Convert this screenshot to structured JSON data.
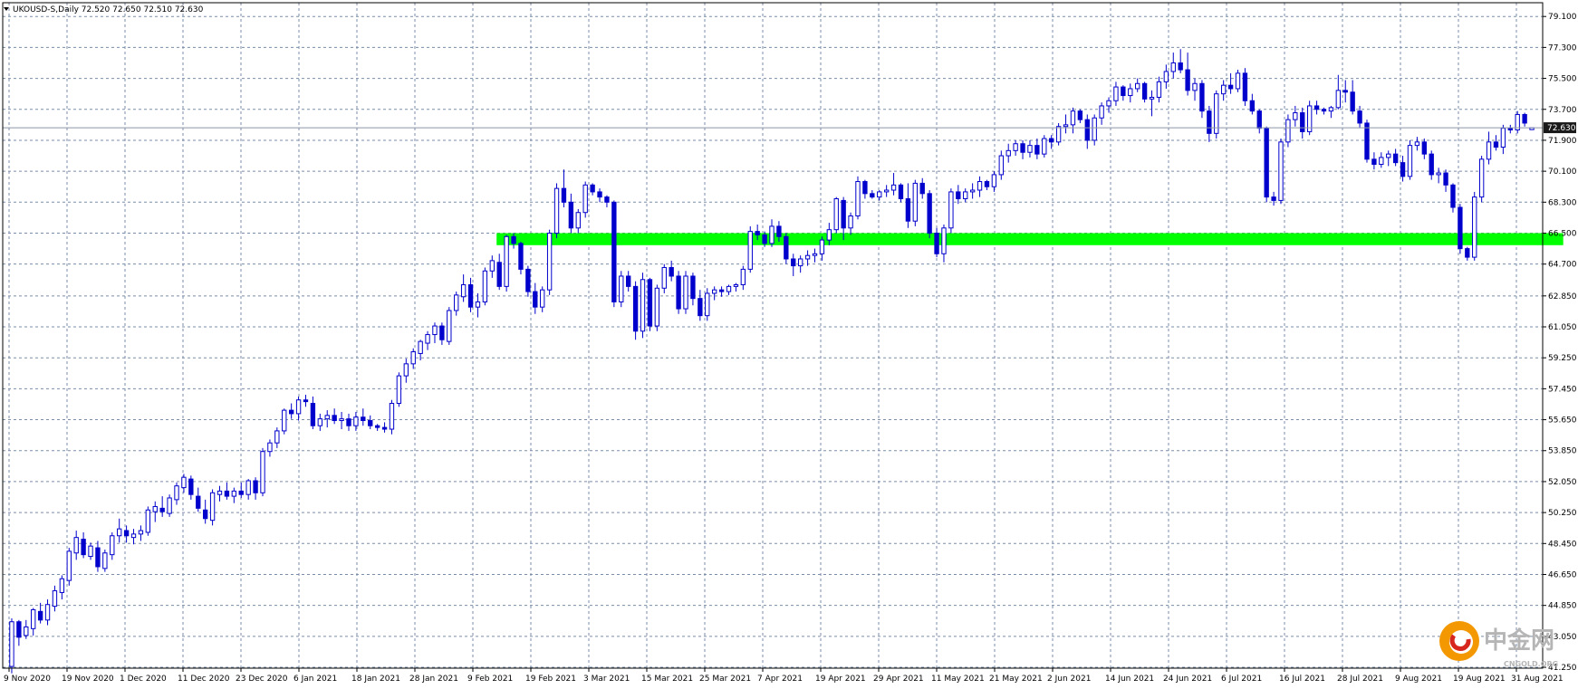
{
  "header": {
    "symbol_line": "UKOUSD-S,Daily  72.520 72.650 72.510 72.630"
  },
  "current_price_label": "72.630",
  "watermark": {
    "name": "中金网",
    "sub": "CNGOLD.ORG"
  },
  "colors": {
    "candle": "#0000cc",
    "support_zone": "#00ff00",
    "grid": "#7b8ea8",
    "frame": "#000000",
    "price_line": "#8c98a8",
    "price_tag": "#1a1a1a",
    "watermark_orange": "#f39800",
    "watermark_red": "#d7261e",
    "watermark_gray": "#b5b5b5"
  },
  "chart_data": {
    "type": "candlestick",
    "symbol": "UKOUSD-S",
    "timeframe": "Daily",
    "ohlc_last": {
      "open": 72.52,
      "high": 72.65,
      "low": 72.51,
      "close": 72.63
    },
    "y_axis": {
      "side": "right",
      "ylim": [
        41.2,
        79.9
      ],
      "ticks": [
        "79.100",
        "77.300",
        "75.500",
        "73.700",
        "71.900",
        "70.100",
        "68.300",
        "66.500",
        "64.700",
        "62.850",
        "61.050",
        "59.250",
        "57.450",
        "55.650",
        "53.850",
        "52.050",
        "50.250",
        "48.450",
        "46.650",
        "44.850",
        "43.050",
        "41.250"
      ]
    },
    "x_axis": {
      "ticks": [
        "9 Nov 2020",
        "19 Nov 2020",
        "1 Dec 2020",
        "11 Dec 2020",
        "23 Dec 2020",
        "6 Jan 2021",
        "18 Jan 2021",
        "28 Jan 2021",
        "9 Feb 2021",
        "19 Feb 2021",
        "3 Mar 2021",
        "15 Mar 2021",
        "25 Mar 2021",
        "7 Apr 2021",
        "19 Apr 2021",
        "29 Apr 2021",
        "11 May 2021",
        "21 May 2021",
        "2 Jun 2021",
        "14 Jun 2021",
        "24 Jun 2021",
        "6 Jul 2021",
        "16 Jul 2021",
        "28 Jul 2021",
        "9 Aug 2021",
        "19 Aug 2021",
        "31 Aug 2021"
      ]
    },
    "grid": true,
    "support_zone": {
      "from": 65.8,
      "to": 66.5
    },
    "current_price": 72.63,
    "candles": [
      [
        41.3,
        44.1,
        40.9,
        43.9
      ],
      [
        43.9,
        44.0,
        42.5,
        43.0
      ],
      [
        43.1,
        44.0,
        42.9,
        43.6
      ],
      [
        43.5,
        44.7,
        43.1,
        44.6
      ],
      [
        44.5,
        45.0,
        43.8,
        44.0
      ],
      [
        44.0,
        45.2,
        43.7,
        44.9
      ],
      [
        44.8,
        46.0,
        44.5,
        45.7
      ],
      [
        45.6,
        46.6,
        45.2,
        46.4
      ],
      [
        46.3,
        48.2,
        46.0,
        48.0
      ],
      [
        47.9,
        49.2,
        47.5,
        48.8
      ],
      [
        48.7,
        49.1,
        47.6,
        47.8
      ],
      [
        47.7,
        48.5,
        47.5,
        48.3
      ],
      [
        48.2,
        48.6,
        46.8,
        47.1
      ],
      [
        47.0,
        48.1,
        46.8,
        47.9
      ],
      [
        47.8,
        49.1,
        47.5,
        48.9
      ],
      [
        48.9,
        49.9,
        48.5,
        49.3
      ],
      [
        49.2,
        49.5,
        48.5,
        48.9
      ],
      [
        48.8,
        49.3,
        48.4,
        49.0
      ],
      [
        49.0,
        49.5,
        48.6,
        49.2
      ],
      [
        49.1,
        50.6,
        48.9,
        50.4
      ],
      [
        50.3,
        50.9,
        49.7,
        50.6
      ],
      [
        50.5,
        51.2,
        50.0,
        50.3
      ],
      [
        50.2,
        51.3,
        50.0,
        51.1
      ],
      [
        51.0,
        52.0,
        50.7,
        51.8
      ],
      [
        51.7,
        52.5,
        51.4,
        52.3
      ],
      [
        52.2,
        52.4,
        51.0,
        51.3
      ],
      [
        51.2,
        51.7,
        50.3,
        50.5
      ],
      [
        50.4,
        51.0,
        49.6,
        49.9
      ],
      [
        49.8,
        51.6,
        49.5,
        51.4
      ],
      [
        51.3,
        51.8,
        50.9,
        51.5
      ],
      [
        51.5,
        52.0,
        51.0,
        51.2
      ],
      [
        51.2,
        51.7,
        50.8,
        51.5
      ],
      [
        51.5,
        52.0,
        51.1,
        51.3
      ],
      [
        51.3,
        52.2,
        51.0,
        52.1
      ],
      [
        52.1,
        52.3,
        51.0,
        51.4
      ],
      [
        51.4,
        54.0,
        51.2,
        53.8
      ],
      [
        53.8,
        54.5,
        53.5,
        54.3
      ],
      [
        54.3,
        55.2,
        54.0,
        55.0
      ],
      [
        55.0,
        56.3,
        54.8,
        56.2
      ],
      [
        56.2,
        56.6,
        55.7,
        56.0
      ],
      [
        56.0,
        57.0,
        55.6,
        56.8
      ],
      [
        56.8,
        57.1,
        56.4,
        56.7
      ],
      [
        56.6,
        57.0,
        55.1,
        55.3
      ],
      [
        55.3,
        56.0,
        55.0,
        55.7
      ],
      [
        55.7,
        56.2,
        55.2,
        55.9
      ],
      [
        55.9,
        56.3,
        55.4,
        55.6
      ],
      [
        55.6,
        56.1,
        55.1,
        55.7
      ],
      [
        55.7,
        56.0,
        55.0,
        55.3
      ],
      [
        55.3,
        56.1,
        55.0,
        55.8
      ],
      [
        55.8,
        56.3,
        55.3,
        55.6
      ],
      [
        55.6,
        55.9,
        55.1,
        55.3
      ],
      [
        55.3,
        55.4,
        55.0,
        55.2
      ],
      [
        55.2,
        55.5,
        54.9,
        55.1
      ],
      [
        55.1,
        56.8,
        54.8,
        56.6
      ],
      [
        56.6,
        58.4,
        56.4,
        58.2
      ],
      [
        58.2,
        59.2,
        57.8,
        58.9
      ],
      [
        58.9,
        59.8,
        58.6,
        59.6
      ],
      [
        59.5,
        60.3,
        59.1,
        60.2
      ],
      [
        60.1,
        60.8,
        59.7,
        60.6
      ],
      [
        60.6,
        61.3,
        60.1,
        61.1
      ],
      [
        61.1,
        61.3,
        60.0,
        60.3
      ],
      [
        60.2,
        62.2,
        60.0,
        62.0
      ],
      [
        62.0,
        63.1,
        61.7,
        62.9
      ],
      [
        62.8,
        64.1,
        62.5,
        63.5
      ],
      [
        63.5,
        63.9,
        61.9,
        62.2
      ],
      [
        62.2,
        63.0,
        61.6,
        62.5
      ],
      [
        62.5,
        64.5,
        62.3,
        64.3
      ],
      [
        64.3,
        65.2,
        63.9,
        64.9
      ],
      [
        64.8,
        65.3,
        63.2,
        63.4
      ],
      [
        63.4,
        66.4,
        63.1,
        66.3
      ],
      [
        66.3,
        66.5,
        65.6,
        65.9
      ],
      [
        65.9,
        66.0,
        64.1,
        64.4
      ],
      [
        64.4,
        64.6,
        62.8,
        63.1
      ],
      [
        63.1,
        63.6,
        61.8,
        62.2
      ],
      [
        62.2,
        63.4,
        61.9,
        63.2
      ],
      [
        63.2,
        66.7,
        62.9,
        66.5
      ],
      [
        66.5,
        69.4,
        66.2,
        69.1
      ],
      [
        69.1,
        70.2,
        68.0,
        68.3
      ],
      [
        68.3,
        68.8,
        66.5,
        66.8
      ],
      [
        66.8,
        67.9,
        66.5,
        67.7
      ],
      [
        67.7,
        69.5,
        67.4,
        69.3
      ],
      [
        69.3,
        69.4,
        68.7,
        68.9
      ],
      [
        68.9,
        69.1,
        68.3,
        68.6
      ],
      [
        68.6,
        68.7,
        68.0,
        68.3
      ],
      [
        68.3,
        68.4,
        62.2,
        62.5
      ],
      [
        62.5,
        64.3,
        62.2,
        64.0
      ],
      [
        64.0,
        64.3,
        63.1,
        63.4
      ],
      [
        63.4,
        63.7,
        60.3,
        60.8
      ],
      [
        60.8,
        64.2,
        60.4,
        63.8
      ],
      [
        63.8,
        63.9,
        60.8,
        61.1
      ],
      [
        61.1,
        63.5,
        60.8,
        63.3
      ],
      [
        63.3,
        64.7,
        63.0,
        64.5
      ],
      [
        64.5,
        64.9,
        63.7,
        64.0
      ],
      [
        64.0,
        64.3,
        61.8,
        62.1
      ],
      [
        62.1,
        64.3,
        61.8,
        64.0
      ],
      [
        64.0,
        64.2,
        62.3,
        62.7
      ],
      [
        62.7,
        63.2,
        61.4,
        61.7
      ],
      [
        61.7,
        63.3,
        61.4,
        63.0
      ],
      [
        63.0,
        63.4,
        62.6,
        63.2
      ],
      [
        63.2,
        63.4,
        62.8,
        63.1
      ],
      [
        63.1,
        63.5,
        62.9,
        63.4
      ],
      [
        63.4,
        63.6,
        63.1,
        63.5
      ],
      [
        63.5,
        64.6,
        63.2,
        64.4
      ],
      [
        64.4,
        66.9,
        64.2,
        66.6
      ],
      [
        66.6,
        67.0,
        66.1,
        66.4
      ],
      [
        66.4,
        66.6,
        65.7,
        65.9
      ],
      [
        65.9,
        67.3,
        65.7,
        66.9
      ],
      [
        66.9,
        67.2,
        66.0,
        66.3
      ],
      [
        66.3,
        66.5,
        64.7,
        65.0
      ],
      [
        65.0,
        65.3,
        64.0,
        64.6
      ],
      [
        64.6,
        65.2,
        64.2,
        65.0
      ],
      [
        65.0,
        65.5,
        64.6,
        65.2
      ],
      [
        65.2,
        65.6,
        64.8,
        65.3
      ],
      [
        65.3,
        66.3,
        64.9,
        66.1
      ],
      [
        66.1,
        67.1,
        65.8,
        66.7
      ],
      [
        66.7,
        68.6,
        66.5,
        68.5
      ],
      [
        68.4,
        68.6,
        66.1,
        66.8
      ],
      [
        66.8,
        67.7,
        66.4,
        67.5
      ],
      [
        67.5,
        69.8,
        67.3,
        69.5
      ],
      [
        69.5,
        69.6,
        68.5,
        68.8
      ],
      [
        68.8,
        69.0,
        68.5,
        68.6
      ],
      [
        68.6,
        69.0,
        68.4,
        68.9
      ],
      [
        68.9,
        69.3,
        68.6,
        69.0
      ],
      [
        69.0,
        70.0,
        68.7,
        69.3
      ],
      [
        69.3,
        69.4,
        68.3,
        68.5
      ],
      [
        68.5,
        69.4,
        66.8,
        67.2
      ],
      [
        67.2,
        69.6,
        66.9,
        69.4
      ],
      [
        69.4,
        69.7,
        68.5,
        68.8
      ],
      [
        68.8,
        69.0,
        66.2,
        66.5
      ],
      [
        66.5,
        66.8,
        65.1,
        65.3
      ],
      [
        65.3,
        67.0,
        64.8,
        66.8
      ],
      [
        66.8,
        69.1,
        66.5,
        68.9
      ],
      [
        68.9,
        69.3,
        68.2,
        68.5
      ],
      [
        68.5,
        69.1,
        68.3,
        68.9
      ],
      [
        68.9,
        69.4,
        68.5,
        69.0
      ],
      [
        69.0,
        69.8,
        68.6,
        69.5
      ],
      [
        69.5,
        69.6,
        69.0,
        69.2
      ],
      [
        69.2,
        70.1,
        68.9,
        69.9
      ],
      [
        69.9,
        71.3,
        69.6,
        71.0
      ],
      [
        71.0,
        71.7,
        70.6,
        71.3
      ],
      [
        71.3,
        71.9,
        71.0,
        71.7
      ],
      [
        71.7,
        71.9,
        70.8,
        71.2
      ],
      [
        71.2,
        71.9,
        70.9,
        71.6
      ],
      [
        71.6,
        72.0,
        70.8,
        71.1
      ],
      [
        71.1,
        72.2,
        70.9,
        72.0
      ],
      [
        72.0,
        72.2,
        71.4,
        71.8
      ],
      [
        71.8,
        72.9,
        71.6,
        72.7
      ],
      [
        72.7,
        73.4,
        72.3,
        72.8
      ],
      [
        72.8,
        73.8,
        72.3,
        73.6
      ],
      [
        73.6,
        73.7,
        72.9,
        73.1
      ],
      [
        73.1,
        73.4,
        71.4,
        71.9
      ],
      [
        71.9,
        73.4,
        71.6,
        73.2
      ],
      [
        73.2,
        74.1,
        72.8,
        73.9
      ],
      [
        73.9,
        74.4,
        73.5,
        74.2
      ],
      [
        74.2,
        75.3,
        73.9,
        75.0
      ],
      [
        75.0,
        75.1,
        74.2,
        74.5
      ],
      [
        74.5,
        75.2,
        74.1,
        74.9
      ],
      [
        74.9,
        75.5,
        74.7,
        75.2
      ],
      [
        75.2,
        75.3,
        74.1,
        74.3
      ],
      [
        74.3,
        74.8,
        73.3,
        74.4
      ],
      [
        74.4,
        75.6,
        74.1,
        75.3
      ],
      [
        75.3,
        76.3,
        74.9,
        75.9
      ],
      [
        75.9,
        77.0,
        75.5,
        76.4
      ],
      [
        76.4,
        77.2,
        75.8,
        76.0
      ],
      [
        76.0,
        77.0,
        74.5,
        74.8
      ],
      [
        74.8,
        75.5,
        74.2,
        75.2
      ],
      [
        75.2,
        75.4,
        73.2,
        73.6
      ],
      [
        73.6,
        73.9,
        71.8,
        72.3
      ],
      [
        72.3,
        74.8,
        72.0,
        74.6
      ],
      [
        74.6,
        75.4,
        74.2,
        75.1
      ],
      [
        75.1,
        75.8,
        74.6,
        74.9
      ],
      [
        74.9,
        76.0,
        74.7,
        75.8
      ],
      [
        75.8,
        76.1,
        73.9,
        74.2
      ],
      [
        74.2,
        74.6,
        73.4,
        73.6
      ],
      [
        73.6,
        73.7,
        72.3,
        72.6
      ],
      [
        72.6,
        72.7,
        68.3,
        68.6
      ],
      [
        68.6,
        68.9,
        68.1,
        68.4
      ],
      [
        68.4,
        72.0,
        68.2,
        71.8
      ],
      [
        71.8,
        73.4,
        71.5,
        73.1
      ],
      [
        73.1,
        73.9,
        72.7,
        73.5
      ],
      [
        73.5,
        73.8,
        72.0,
        72.4
      ],
      [
        72.4,
        74.2,
        72.2,
        73.9
      ],
      [
        73.9,
        74.2,
        73.4,
        73.7
      ],
      [
        73.7,
        73.8,
        73.4,
        73.6
      ],
      [
        73.6,
        73.9,
        73.2,
        73.8
      ],
      [
        73.8,
        75.7,
        73.7,
        74.8
      ],
      [
        74.8,
        75.4,
        74.1,
        74.7
      ],
      [
        74.7,
        75.4,
        73.4,
        73.6
      ],
      [
        73.6,
        73.9,
        72.6,
        72.9
      ],
      [
        72.9,
        73.1,
        70.6,
        70.8
      ],
      [
        70.8,
        71.2,
        70.2,
        70.5
      ],
      [
        70.5,
        71.2,
        70.3,
        70.9
      ],
      [
        70.9,
        71.3,
        70.4,
        71.1
      ],
      [
        71.1,
        71.4,
        70.4,
        70.6
      ],
      [
        70.6,
        71.0,
        69.5,
        69.8
      ],
      [
        69.8,
        71.9,
        69.6,
        71.6
      ],
      [
        71.6,
        72.1,
        71.3,
        71.8
      ],
      [
        71.8,
        72.0,
        70.8,
        71.1
      ],
      [
        71.1,
        71.3,
        69.6,
        69.9
      ],
      [
        69.9,
        70.3,
        69.4,
        70.0
      ],
      [
        70.0,
        70.2,
        68.9,
        69.3
      ],
      [
        69.3,
        69.4,
        67.7,
        68.0
      ],
      [
        68.0,
        68.2,
        65.3,
        65.6
      ],
      [
        65.6,
        65.7,
        64.9,
        65.1
      ],
      [
        65.1,
        68.9,
        64.9,
        68.6
      ],
      [
        68.6,
        71.0,
        68.3,
        70.8
      ],
      [
        70.8,
        72.4,
        70.5,
        71.8
      ],
      [
        71.8,
        72.2,
        71.3,
        71.5
      ],
      [
        71.5,
        72.8,
        71.1,
        72.6
      ],
      [
        72.6,
        72.8,
        72.3,
        72.5
      ],
      [
        72.5,
        73.6,
        72.3,
        73.4
      ],
      [
        73.4,
        73.5,
        72.7,
        72.9
      ],
      [
        72.52,
        72.65,
        72.51,
        72.63
      ]
    ]
  }
}
